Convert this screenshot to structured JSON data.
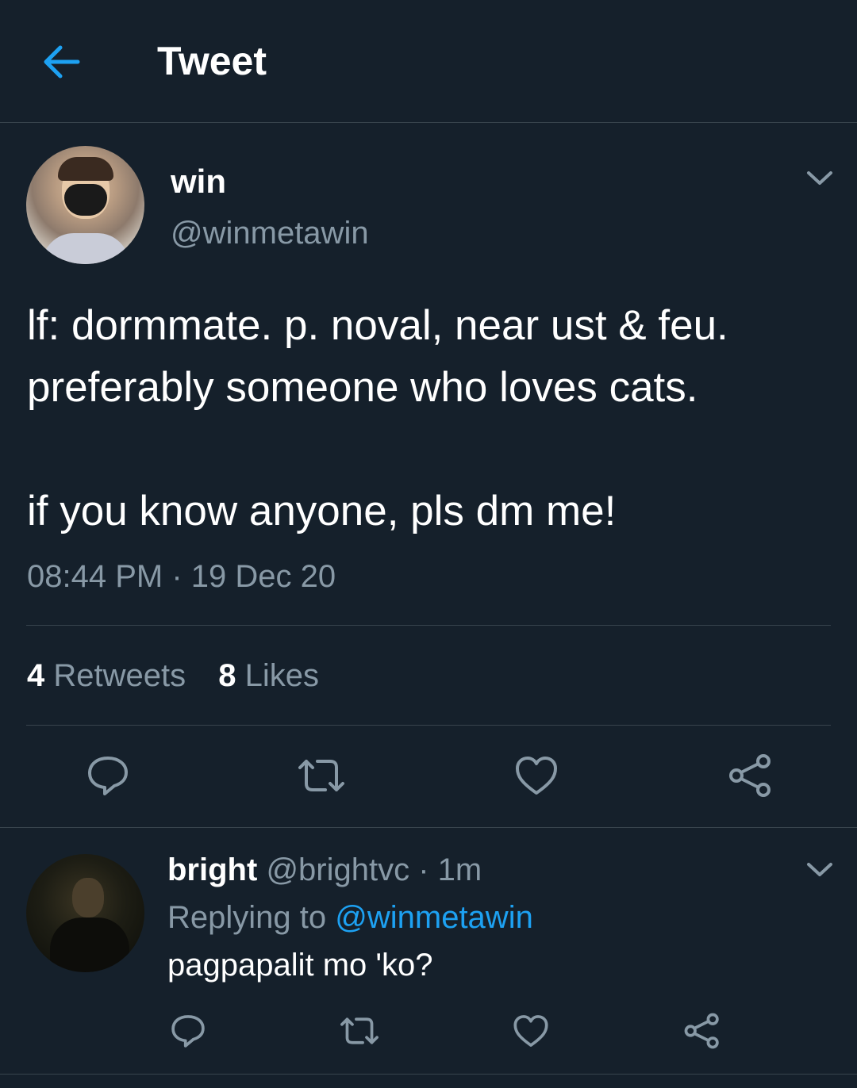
{
  "header": {
    "title": "Tweet"
  },
  "tweet": {
    "author_name": "win",
    "author_handle": "@winmetawin",
    "line1": "lf: dormmate. p. noval, near ust & feu.",
    "line2": "preferably someone who loves cats.",
    "line3": "if you know anyone, pls dm me!",
    "time": "08:44 PM",
    "sep": " · ",
    "date": "19 Dec 20",
    "retweets_count": "4",
    "retweets_label": "Retweets",
    "likes_count": "8",
    "likes_label": "Likes"
  },
  "reply": {
    "author_name": "bright",
    "author_handle": "@brightvc",
    "sep": " · ",
    "age": "1m",
    "replying_label": "Replying to",
    "replying_to": "@winmetawin",
    "text": "pagpapalit mo 'ko?"
  },
  "colors": {
    "background": "#15202b",
    "accent": "#1da1f2",
    "secondary_text": "#8899a6",
    "divider": "#38444d"
  },
  "icons": [
    "back-arrow-icon",
    "chevron-down-icon",
    "reply-icon",
    "retweet-icon",
    "like-icon",
    "share-icon"
  ]
}
